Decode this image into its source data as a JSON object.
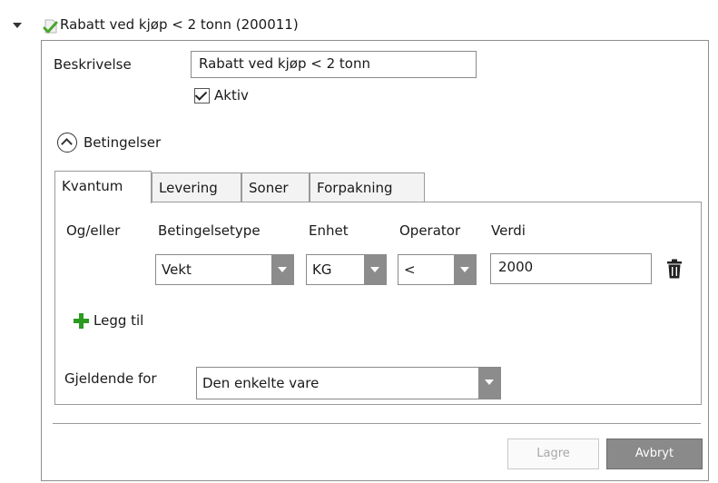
{
  "node": {
    "icon": "check-leaf-icon",
    "title": "Rabatt ved kjøp < 2 tonn (200011)"
  },
  "form": {
    "description_label": "Beskrivelse",
    "description_value": "Rabatt ved kjøp < 2 tonn",
    "active_label": "Aktiv",
    "active_checked": true,
    "conditions_label": "Betingelser"
  },
  "tabs": [
    {
      "label": "Kvantum",
      "active": true
    },
    {
      "label": "Levering",
      "active": false
    },
    {
      "label": "Soner",
      "active": false
    },
    {
      "label": "Forpakning",
      "active": false
    }
  ],
  "condition_table": {
    "headers": [
      "Og/eller",
      "Betingelsetype",
      "Enhet",
      "Operator",
      "Verdi"
    ],
    "row": {
      "type": "Vekt",
      "unit": "KG",
      "operator": "<",
      "value": "2000"
    }
  },
  "add_label": "Legg til",
  "applies_to": {
    "label": "Gjeldende for",
    "value": "Den enkelte vare"
  },
  "footer": {
    "save_label": "Lagre",
    "cancel_label": "Avbryt"
  },
  "colors": {
    "add_green": "#2c9a1f",
    "combo_button": "#8c8c8c",
    "cancel_button": "#8a8a8a"
  }
}
